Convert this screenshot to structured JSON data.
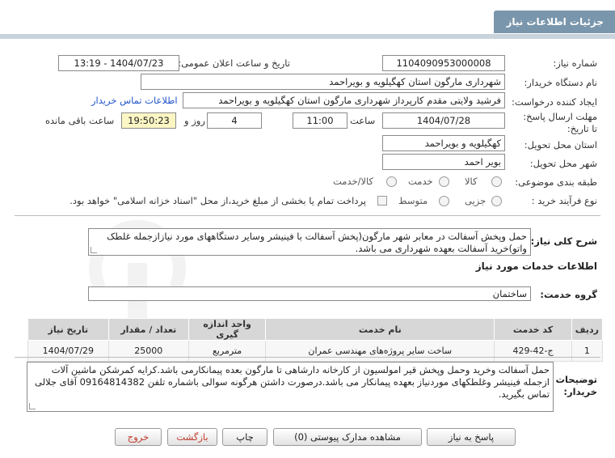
{
  "header": {
    "title": "جزئیات اطلاعات نیاز"
  },
  "form": {
    "need_number_label": "شماره نیاز:",
    "need_number": "1104090953000008",
    "announce_label": "تاریخ و ساعت اعلان عمومی:",
    "announce_value": "1404/07/23 - 13:19",
    "buyer_label": "نام دستگاه خریدار:",
    "buyer_value": "شهرداری مارگون استان کهگیلویه و بویراحمد",
    "creator_label": "ایجاد کننده درخواست:",
    "creator_value": "فرشید  ولایتی مقدم  کارپرداز شهرداری مارگون استان کهگیلویه و بویراحمد",
    "contact_link": "اطلاعات تماس خریدار",
    "deadline_label": "مهلت ارسال پاسخ: تا تاریخ:",
    "deadline_date": "1404/07/28",
    "time_label": "ساعت",
    "deadline_time": "11:00",
    "days_value": "4",
    "days_label": "روز و",
    "remaining_time": "19:50:23",
    "remaining_label": "ساعت باقی مانده",
    "province_label": "استان محل تحویل:",
    "province_value": "کهگیلویه و بویراحمد",
    "city_label": "شهر محل تحویل:",
    "city_value": "بویر احمد",
    "category_label": "طبقه بندی موضوعی:",
    "category_options": [
      "کالا",
      "خدمت",
      "کالا/خدمت"
    ],
    "process_label": "نوع فرآیند خرید :",
    "process_options": [
      "جزیی",
      "متوسط"
    ],
    "payment_note": "پرداخت تمام یا بخشی از مبلغ خرید،از محل \"اسناد خزانه اسلامی\" خواهد بود."
  },
  "description": {
    "label": "شرح کلی نیاز:",
    "text": "حمل وپخش آسفالت در معابر شهر مارگون(پخش آسفالت با فینیشر وسایر دستگاههای مورد نیازازجمله غلطک واتو)خرید آسفالت بعهده شهرداری می باشد."
  },
  "services": {
    "section_title": "اطلاعات خدمات مورد نیاز",
    "group_label": "گروه خدمت:",
    "group_value": "ساختمان",
    "columns": [
      "ردیف",
      "کد خدمت",
      "نام خدمت",
      "واحد اندازه گیری",
      "تعداد / مقدار",
      "تاریخ نیاز"
    ],
    "rows": [
      {
        "row": "1",
        "code": "ج-42-429",
        "name": "ساخت سایر پروژه‌های مهندسی عمران",
        "unit": "مترمربع",
        "qty": "25000",
        "date": "1404/07/29"
      }
    ]
  },
  "buyer_notes": {
    "label": "توضیحات خریدار:",
    "text": "حمل آسفالت وخرید وحمل وپخش قیر امولسیون از کارخانه دارشاهی تا مارگون بعده پیمانکارمی باشد.کرایه کمرشکن ماشین آلات ازجمله فینیشر وغلطکهای موردنیاز بعهده پیمانکار می باشد.درصورت داشتن هرگونه سوالی باشماره تلفن 09164814382 آقای جلالی تماس بگیرید."
  },
  "buttons": {
    "reply": "پاسخ به نیاز",
    "attachments": "مشاهده مدارک پیوستی (0)",
    "print": "چاپ",
    "back": "بازگشت",
    "exit": "خروج"
  },
  "colors": {
    "header_bg": "#7a96ac",
    "highlight": "#fbf6c4",
    "link": "#2255cc"
  }
}
